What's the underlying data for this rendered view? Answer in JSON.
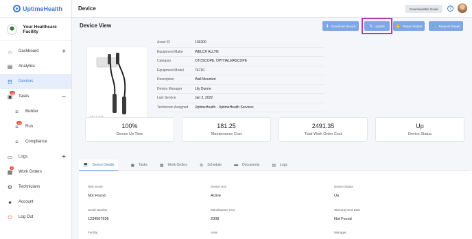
{
  "app": {
    "name": "UptimeHealth"
  },
  "facility": {
    "name": "Your Healthcare Facility"
  },
  "nav": [
    {
      "label": "Dashboard",
      "icon": "home-icon",
      "plus": "+"
    },
    {
      "label": "Analytics",
      "icon": "chart-icon"
    },
    {
      "label": "Devices",
      "icon": "devices-icon",
      "active": true
    },
    {
      "label": "Tasks",
      "icon": "tasks-icon",
      "badge": "13",
      "toggle": "−"
    },
    {
      "label": "Builder",
      "icon": "builder-icon",
      "sub": true
    },
    {
      "label": "Run",
      "icon": "run-icon",
      "sub": true,
      "badge": "13"
    },
    {
      "label": "Compliance",
      "icon": "compliance-icon",
      "sub": true
    },
    {
      "label": "Logs",
      "icon": "logs-icon",
      "plus": "+"
    },
    {
      "label": "Work Orders",
      "icon": "work-orders-icon",
      "badge": "6"
    },
    {
      "label": "Technicians",
      "icon": "gear-icon"
    },
    {
      "label": "Account",
      "icon": "account-icon"
    },
    {
      "label": "Log Out",
      "icon": "power-icon"
    }
  ],
  "topbar": {
    "title": "Device",
    "guide_label": "Downloadable Guide",
    "help": "?"
  },
  "device": {
    "view_title": "Device View",
    "actions": {
      "download": "Download Record",
      "update": "Update",
      "report": "Report Repair",
      "request": "Request Repair"
    },
    "image_caption": "371 × 371",
    "fields": [
      {
        "key": "Asset ID",
        "value": "139200"
      },
      {
        "key": "Equipment Make",
        "value": "WELCH ALLYN"
      },
      {
        "key": "Category",
        "value": "OTOSCOPE, OPTHALMASCOPE"
      },
      {
        "key": "Equipment Model",
        "value": "74710"
      },
      {
        "key": "Description",
        "value": "Wall Mounted"
      },
      {
        "key": "Device Manager",
        "value": "Lily Dunne"
      },
      {
        "key": "Last Service",
        "value": "Jan 3, 2022"
      },
      {
        "key": "Technician Assigned",
        "value": "UptimeHealth - UptimeHealth Services"
      }
    ]
  },
  "stats": [
    {
      "value": "100%",
      "label": "Device Up Time"
    },
    {
      "value": "181.25",
      "label": "Maintenance Cost"
    },
    {
      "value": "2491.35",
      "label": "Total Work Order Cost"
    },
    {
      "value": "Up",
      "label": "Device Status"
    }
  ],
  "tabs": [
    {
      "label": "Device Details",
      "icon": "laptop-icon",
      "active": true
    },
    {
      "label": "Tasks",
      "icon": "tasks-icon"
    },
    {
      "label": "Work Orders",
      "icon": "work-orders-icon"
    },
    {
      "label": "Schedule",
      "icon": "schedule-icon"
    },
    {
      "label": "Documents",
      "icon": "folder-icon"
    },
    {
      "label": "Logs",
      "icon": "logs-icon"
    }
  ],
  "info": [
    {
      "label": "Risk Score",
      "value": "Not Found"
    },
    {
      "label": "Device Use",
      "value": "Active"
    },
    {
      "label": "Device Status",
      "value": "Up"
    },
    {
      "label": "Serial Number",
      "value": "1234567936"
    },
    {
      "label": "Manufacture Year",
      "value": "2008"
    },
    {
      "label": "Warranty End Date",
      "value": "Not Found"
    },
    {
      "label": "Facility",
      "value": ""
    },
    {
      "label": "Area",
      "value": ""
    },
    {
      "label": "Manager",
      "value": ""
    }
  ],
  "colors": {
    "accent": "#3a7bd5",
    "button": "#7fa7e6",
    "highlight": "#b03ab8",
    "badge": "#e74c3c"
  }
}
